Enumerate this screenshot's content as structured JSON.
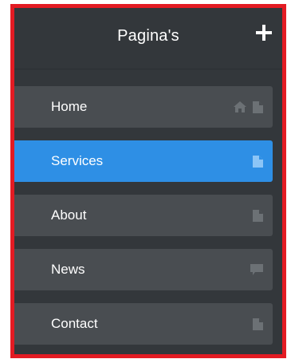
{
  "header": {
    "title": "Pagina's",
    "add_icon": "plus-icon"
  },
  "colors": {
    "panel_bg": "#33373b",
    "item_bg": "#494d51",
    "active_bg": "#2e8fe5",
    "icon_gray": "#6c7175",
    "icon_active": "#8cc5f6",
    "frame": "#e31b23"
  },
  "pages": [
    {
      "label": "Home",
      "active": false,
      "icons": [
        "home-icon",
        "page-icon"
      ]
    },
    {
      "label": "Services",
      "active": true,
      "icons": [
        "page-icon"
      ]
    },
    {
      "label": "About",
      "active": false,
      "icons": [
        "page-icon"
      ]
    },
    {
      "label": "News",
      "active": false,
      "icons": [
        "comment-icon"
      ]
    },
    {
      "label": "Contact",
      "active": false,
      "icons": [
        "page-icon"
      ]
    }
  ]
}
